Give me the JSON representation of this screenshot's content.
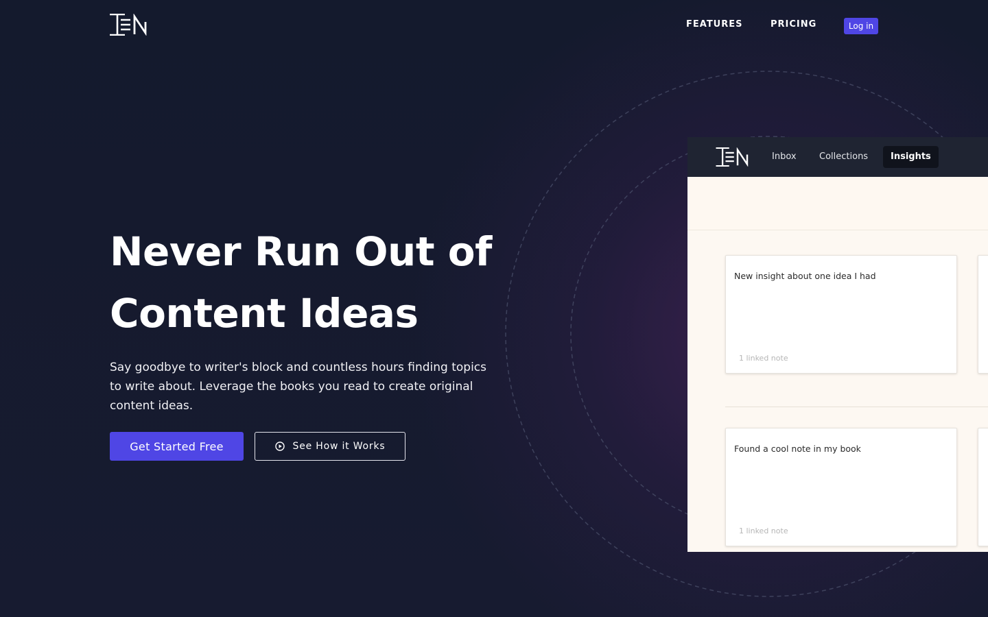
{
  "header": {
    "logo_icon": "ten-logo",
    "nav": [
      {
        "label": "FEATURES"
      },
      {
        "label": "PRICING"
      }
    ],
    "login_label": "Log in"
  },
  "hero": {
    "title_line1": "Never Run Out of",
    "title_line2": "Content Ideas",
    "subtitle": "Say goodbye to writer's block and countless hours finding topics to write about. Leverage the books you read to create original content ideas.",
    "primary_cta": "Get Started Free",
    "secondary_cta": "See How it Works",
    "secondary_icon": "play-circle-icon"
  },
  "preview": {
    "logo_icon": "ten-logo",
    "tabs": [
      {
        "label": "Inbox",
        "active": false
      },
      {
        "label": "Collections",
        "active": false
      },
      {
        "label": "Insights",
        "active": true
      }
    ],
    "cards": [
      {
        "title": "New insight about one idea I had",
        "meta": "1 linked note"
      },
      {
        "title": "Found a cool note in my book",
        "meta": "1 linked note"
      }
    ]
  },
  "colors": {
    "accent": "#4f46e5",
    "background": "#151a2e",
    "app_bar": "#1f2432",
    "preview_bg": "#fdf8f2"
  }
}
